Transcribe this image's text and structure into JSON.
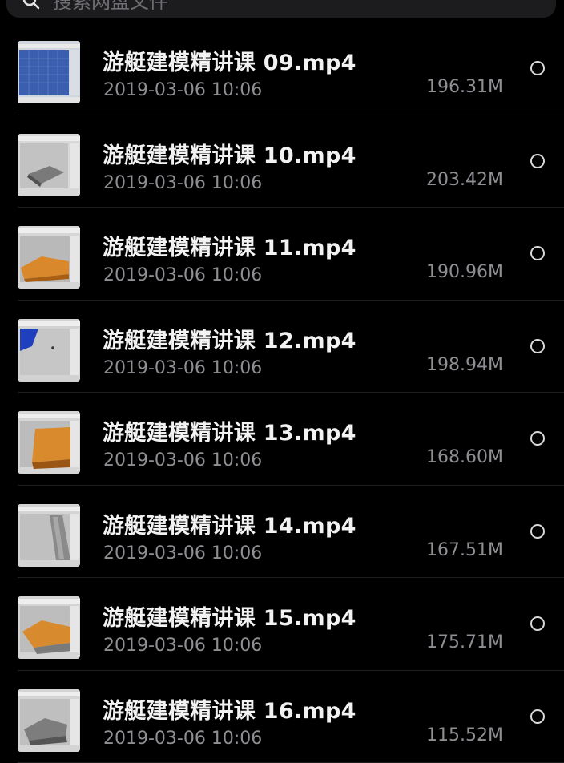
{
  "search": {
    "placeholder": "搜索网盘文件"
  },
  "colors": {
    "background": "#000000",
    "text_primary": "#f2f2f2",
    "text_secondary": "#8e8e93"
  },
  "files": [
    {
      "name": "游艇建模精讲课 09.mp4",
      "date": "2019-03-06 10:06",
      "size": "196.31M",
      "thumb": "blue-grid"
    },
    {
      "name": "游艇建模精讲课 10.mp4",
      "date": "2019-03-06 10:06",
      "size": "203.42M",
      "thumb": "gray-model"
    },
    {
      "name": "游艇建模精讲课 11.mp4",
      "date": "2019-03-06 10:06",
      "size": "190.96M",
      "thumb": "orange-deck"
    },
    {
      "name": "游艇建模精讲课 12.mp4",
      "date": "2019-03-06 10:06",
      "size": "198.94M",
      "thumb": "blue-corner"
    },
    {
      "name": "游艇建模精讲课 13.mp4",
      "date": "2019-03-06 10:06",
      "size": "168.60M",
      "thumb": "orange-block"
    },
    {
      "name": "游艇建模精讲课 14.mp4",
      "date": "2019-03-06 10:06",
      "size": "167.51M",
      "thumb": "gray-hull"
    },
    {
      "name": "游艇建模精讲课 15.mp4",
      "date": "2019-03-06 10:06",
      "size": "175.71M",
      "thumb": "orange-hull"
    },
    {
      "name": "游艇建模精讲课 16.mp4",
      "date": "2019-03-06 10:06",
      "size": "115.52M",
      "thumb": "gray-hull-2"
    }
  ]
}
